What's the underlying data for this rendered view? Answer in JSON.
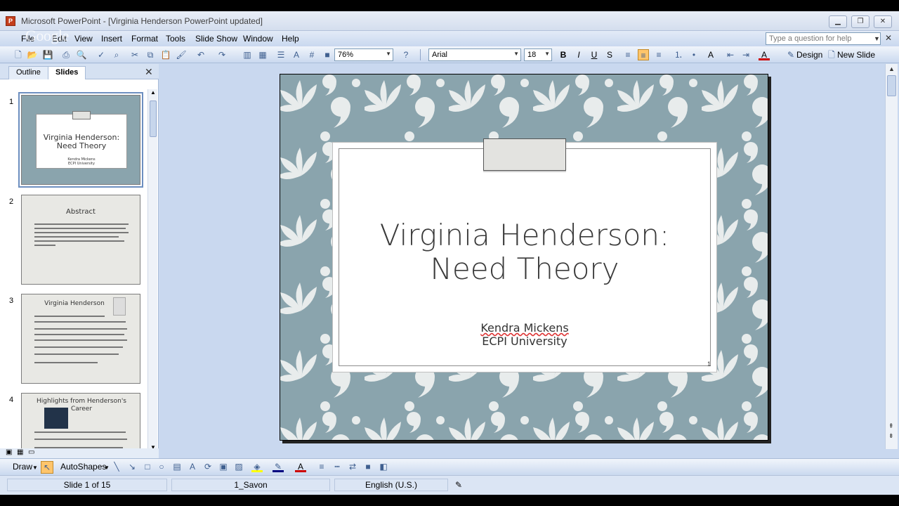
{
  "window": {
    "title": "Microsoft PowerPoint - [Virginia Henderson PowerPoint updated]",
    "watermark": "Google"
  },
  "menu": {
    "items": [
      "File",
      "Edit",
      "View",
      "Insert",
      "Format",
      "Tools",
      "Slide Show",
      "Window",
      "Help"
    ],
    "help_placeholder": "Type a question for help"
  },
  "toolbar": {
    "zoom": "76%",
    "font": "Arial",
    "font_size": "18",
    "design_label": "Design",
    "new_slide_label": "New Slide"
  },
  "panel": {
    "tabs": [
      "Outline",
      "Slides"
    ],
    "active_tab": "Slides",
    "thumbnails": [
      {
        "number": "1",
        "title": "Virginia Henderson: Need Theory",
        "subtitle": "Kendra Mickens ECPI University"
      },
      {
        "number": "2",
        "title": "Abstract"
      },
      {
        "number": "3",
        "title": "Virginia Henderson"
      },
      {
        "number": "4",
        "title": "Highlights from Henderson's Career"
      }
    ]
  },
  "slide": {
    "title": "Virginia Henderson:\nNeed Theory",
    "author": "Kendra Mickens",
    "institution": "ECPI University",
    "number": "1",
    "pattern_color": "#8aa4ad"
  },
  "drawbar": {
    "draw_label": "Draw",
    "autoshapes_label": "AutoShapes"
  },
  "status": {
    "slide_position": "Slide 1 of 15",
    "design_name": "1_Savon",
    "language": "English (U.S.)"
  }
}
